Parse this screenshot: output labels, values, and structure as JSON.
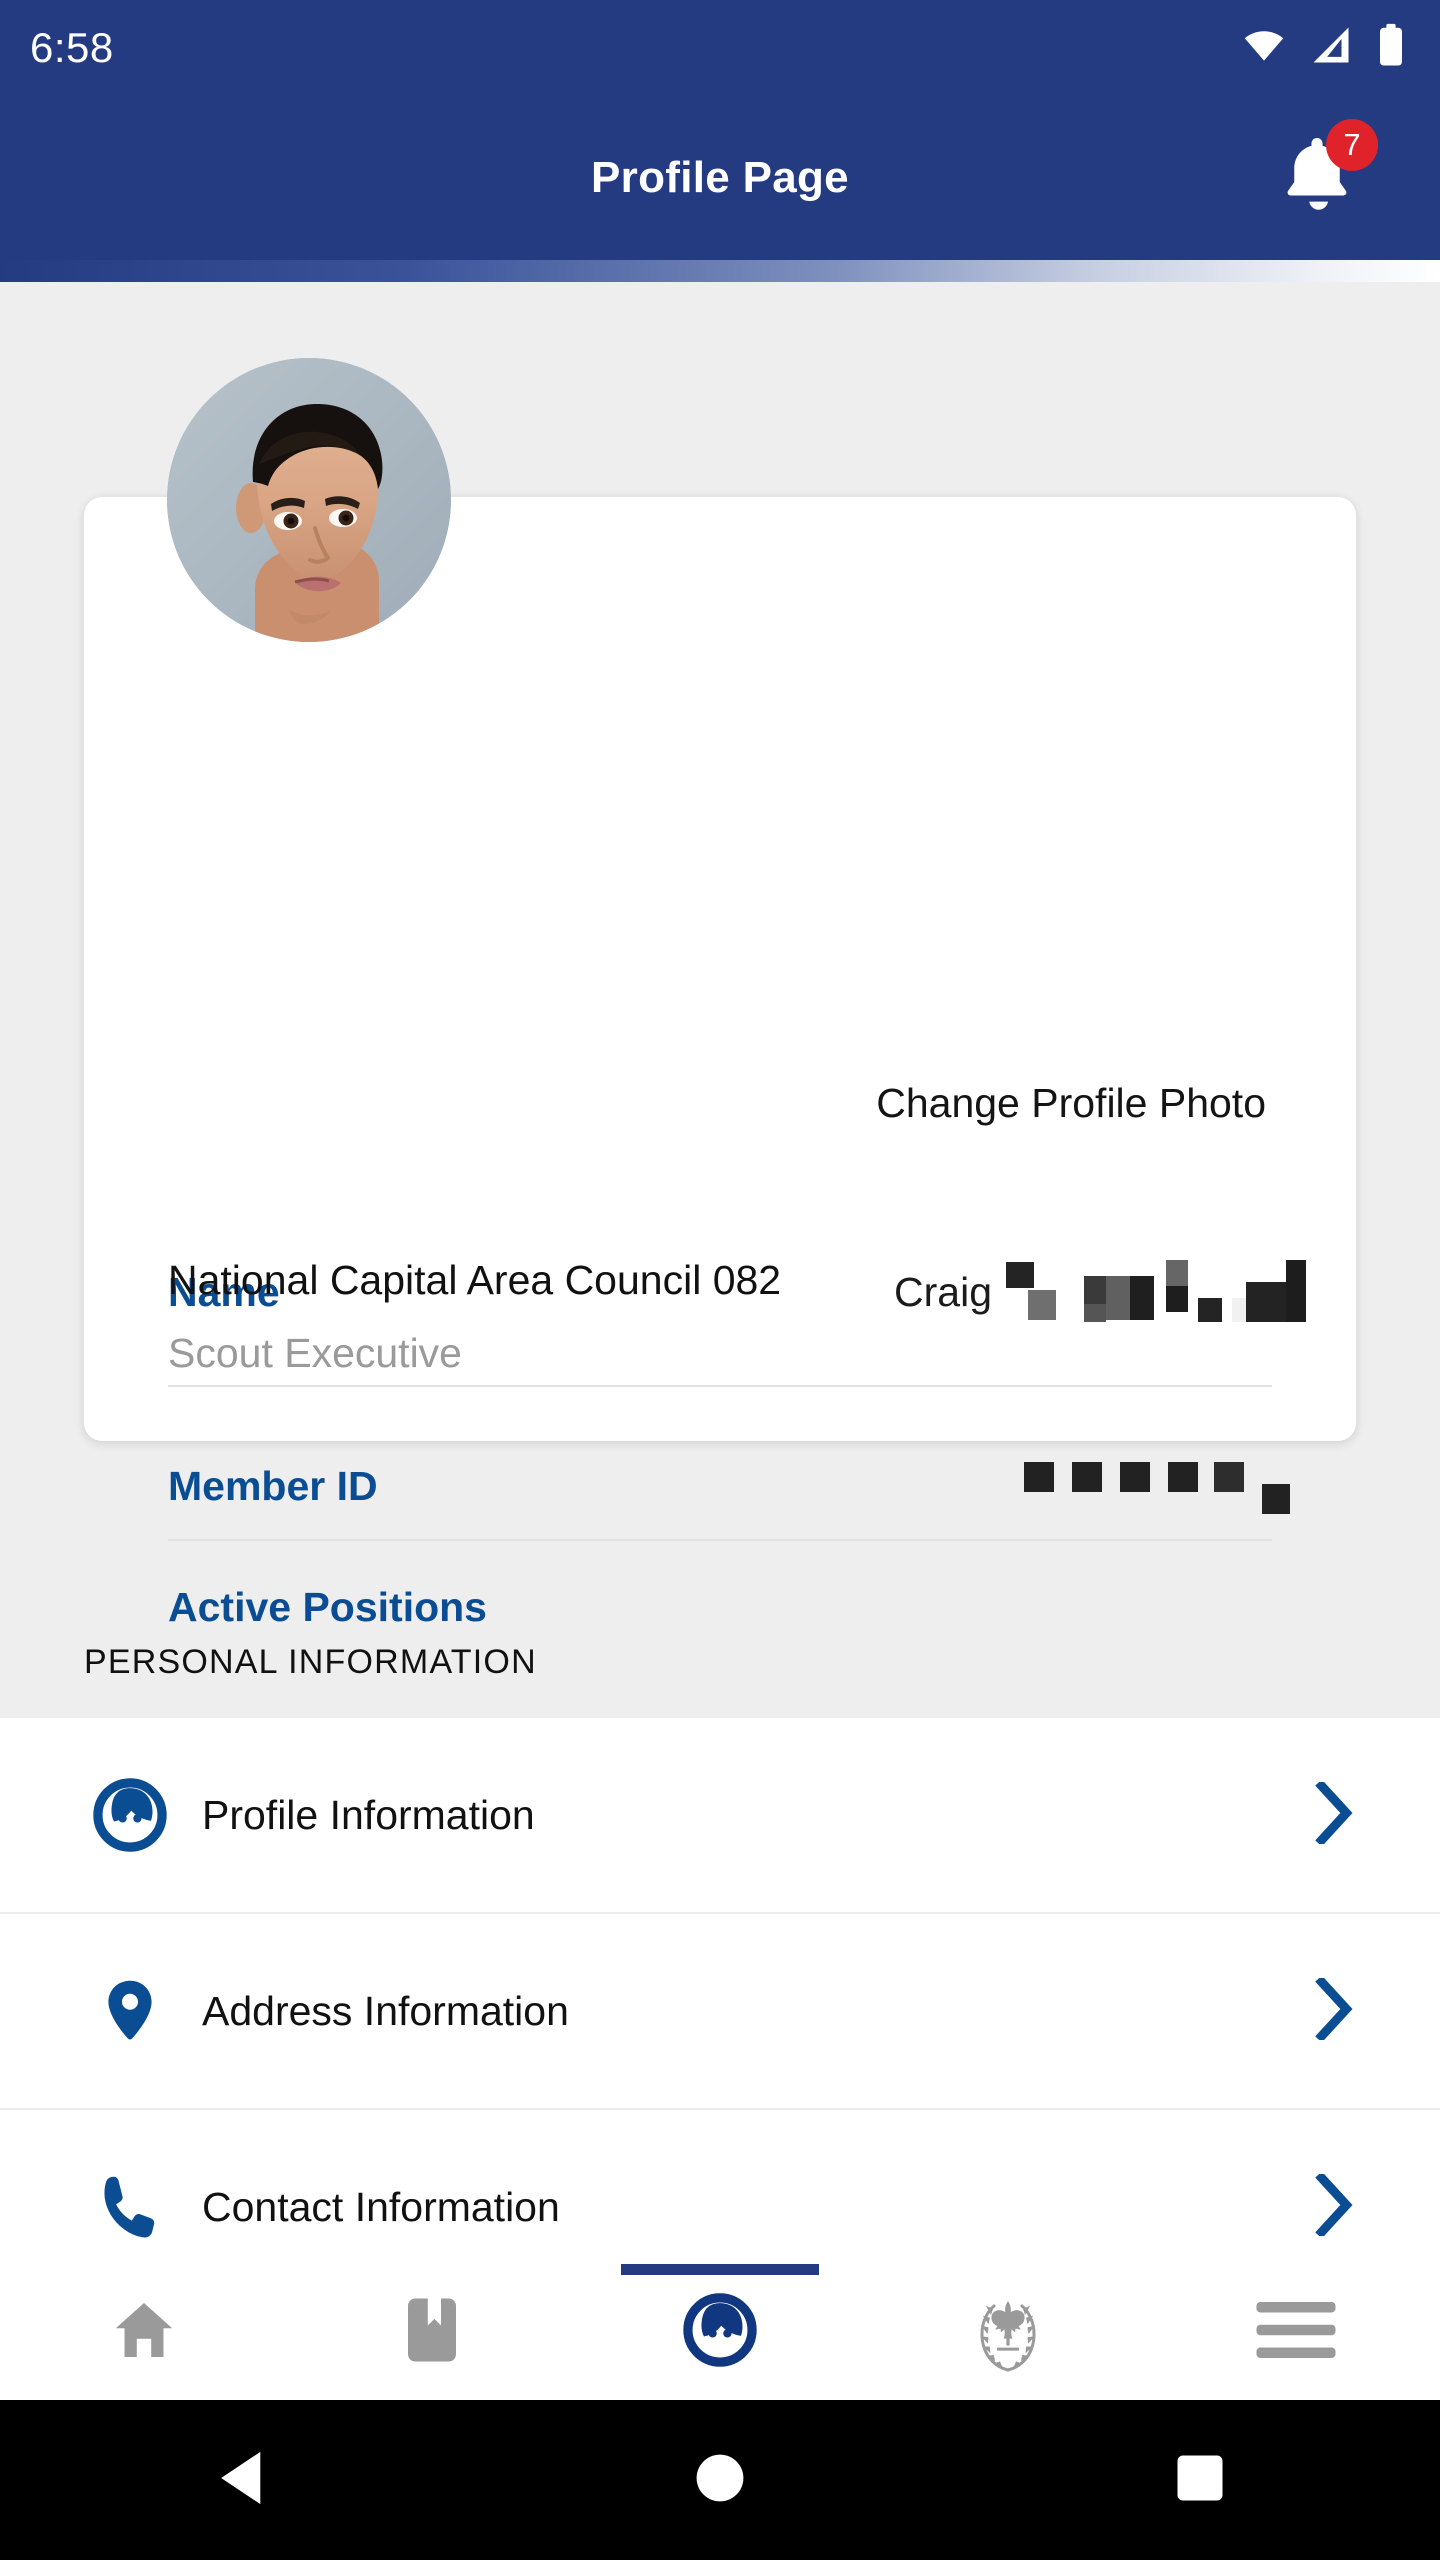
{
  "status_bar": {
    "clock": "6:58",
    "icons": [
      "wifi-icon",
      "cellular-signal-icon",
      "battery-icon"
    ]
  },
  "app_bar": {
    "title": "Profile Page",
    "notification_icon": "bell-icon",
    "notification_count": "7",
    "badge_color": "#e0232b",
    "background_color": "#243b82"
  },
  "profile_card": {
    "avatar_icon": "user-avatar-photo",
    "change_photo_label": "Change Profile Photo",
    "fields": [
      {
        "label": "Name",
        "value": "Craig",
        "value_redacted": true
      },
      {
        "label": "Member ID",
        "value": "",
        "value_redacted": true
      }
    ],
    "active_positions": {
      "heading": "Active Positions",
      "organization": "National Capital Area Council 082",
      "role": "Scout Executive"
    },
    "label_color": "#0b4d93"
  },
  "personal_information": {
    "section_title": "PERSONAL INFORMATION",
    "items": [
      {
        "label": "Profile Information",
        "icon": "person-circle-icon",
        "chevron": "chevron-right-icon"
      },
      {
        "label": "Address Information",
        "icon": "map-pin-icon",
        "chevron": "chevron-right-icon"
      },
      {
        "label": "Contact Information",
        "icon": "phone-icon",
        "chevron": "chevron-right-icon"
      }
    ]
  },
  "bottom_nav": {
    "active_index": 2,
    "tabs": [
      {
        "icon": "home-icon",
        "active": false
      },
      {
        "icon": "bookmark-icon",
        "active": false
      },
      {
        "icon": "person-circle-icon",
        "active": true
      },
      {
        "icon": "scout-emblem-icon",
        "active": false
      },
      {
        "icon": "hamburger-menu-icon",
        "active": false
      }
    ],
    "indicator_color": "#243b82"
  },
  "android_nav": {
    "buttons": [
      {
        "icon": "back-triangle-icon"
      },
      {
        "icon": "home-circle-icon"
      },
      {
        "icon": "recents-square-icon"
      }
    ]
  }
}
